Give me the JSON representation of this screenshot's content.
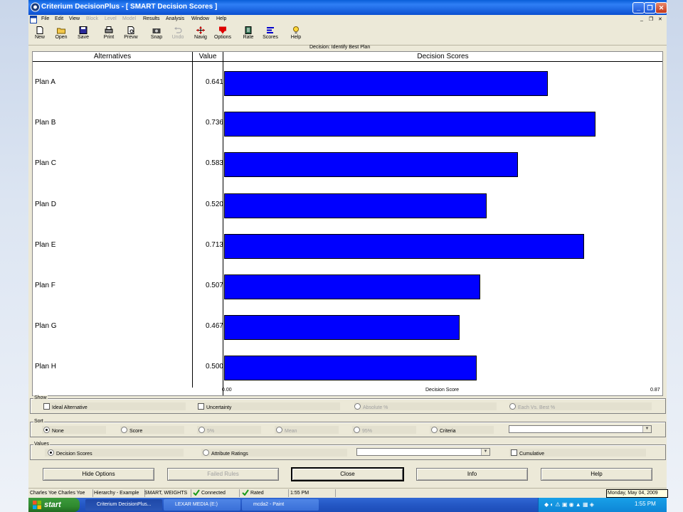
{
  "window": {
    "title": "Criterium DecisionPlus - [ SMART Decision Scores ]",
    "min_glyph": "_",
    "max_glyph": "❐",
    "close_glyph": "✕",
    "doc_min_glyph": "_",
    "doc_max_glyph": "❐",
    "doc_close_glyph": "✕"
  },
  "menu": [
    "File",
    "Edit",
    "View",
    "Block",
    "Level",
    "Model",
    "Results",
    "Analysis",
    "Window",
    "Help"
  ],
  "menu_disabled": [
    "Block",
    "Level",
    "Model"
  ],
  "toolbar": [
    {
      "label": "New",
      "icon": "new-document-icon"
    },
    {
      "label": "Open",
      "icon": "open-folder-icon"
    },
    {
      "label": "Save",
      "icon": "save-disk-icon"
    },
    {
      "label": "Print",
      "icon": "printer-icon"
    },
    {
      "label": "Prevw",
      "icon": "print-preview-icon"
    },
    {
      "label": "Snap",
      "icon": "camera-icon"
    },
    {
      "label": "Undo",
      "icon": "undo-icon",
      "disabled": true
    },
    {
      "label": "Navig",
      "icon": "navigator-icon"
    },
    {
      "label": "Options",
      "icon": "options-icon"
    },
    {
      "label": "Rate",
      "icon": "rate-icon"
    },
    {
      "label": "Scores",
      "icon": "scores-icon"
    },
    {
      "label": "Help",
      "icon": "help-bulb-icon"
    }
  ],
  "decision_title": "Decision: Identify Best Plan",
  "chart_data": {
    "type": "bar",
    "orientation": "horizontal",
    "columns": {
      "alternatives": "Alternatives",
      "value": "Value",
      "scores": "Decision Scores"
    },
    "categories": [
      "Plan A",
      "Plan B",
      "Plan C",
      "Plan D",
      "Plan E",
      "Plan F",
      "Plan G",
      "Plan H"
    ],
    "values": [
      0.641,
      0.736,
      0.583,
      0.52,
      0.713,
      0.507,
      0.467,
      0.5
    ],
    "value_labels": [
      "0.641",
      "0.736",
      "0.583",
      "0.520",
      "0.713",
      "0.507",
      "0.467",
      "0.500"
    ],
    "xlabel": "Decision Score",
    "xlim": [
      0,
      0.87
    ],
    "xmin_label": "0.00",
    "xmax_label": "0.87",
    "bar_color": "#0000ff"
  },
  "show_panel": {
    "legend": "Show",
    "ideal": "Ideal Alternative",
    "uncertainty": "Uncertainty",
    "absolute": "Absolute %",
    "each_vs_best": "Each Vs. Best %"
  },
  "sort_panel": {
    "legend": "Sort",
    "none": "None",
    "score": "Score",
    "p5": "5%",
    "mean": "Mean",
    "p95": "95%",
    "criteria": "Criteria",
    "criteria_value": ""
  },
  "values_panel": {
    "legend": "Values",
    "decision_scores": "Decision Scores",
    "attribute_ratings": "Attribute Ratings",
    "cumulative": "Cumulative",
    "select_value": ""
  },
  "buttons": {
    "hide_options": "Hide Options",
    "failed_rules": "Failed Rules",
    "close": "Close",
    "info": "Info",
    "help": "Help"
  },
  "status": {
    "user": "Charles Yoe Charles Yoe",
    "hierarchy": "Hierarchy - Example",
    "method": "SMART, WEIGHTS",
    "connected": "Connected",
    "rated": "Rated",
    "time": "1:55 PM",
    "date": "Monday, May 04, 2009"
  },
  "taskbar": {
    "start": "start",
    "tasks": [
      "Criterium DecisionPlus...",
      "LEXAR MEDIA (E:)",
      "mcda2 - Paint"
    ],
    "clock": "1:55 PM"
  },
  "colors": {
    "bar": "#0000ff",
    "titlebar": "#0b4fd0",
    "taskbar": "#2457c4",
    "start": "#2f8a2f"
  }
}
